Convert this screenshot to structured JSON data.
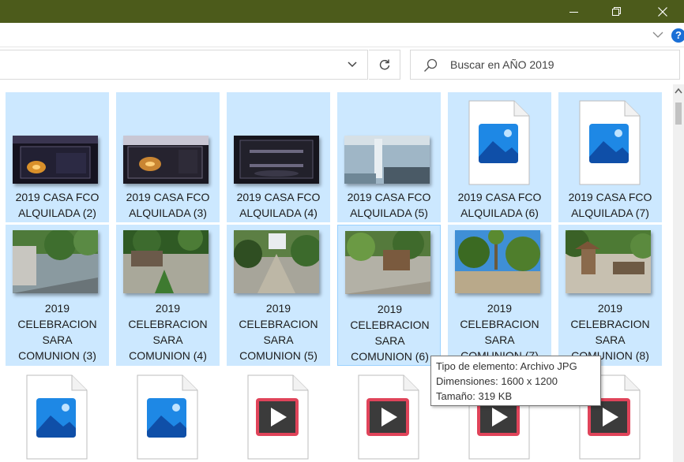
{
  "window": {
    "accent": "#4c5b1b",
    "buttons": [
      "minimize-icon",
      "maximize-icon",
      "close-icon"
    ]
  },
  "ribbon": {
    "help_label": "?"
  },
  "search": {
    "placeholder": "Buscar en AÑO 2019"
  },
  "row1": [
    {
      "line1": "2019 CASA FCO",
      "line2": "ALQUILADA (2)",
      "kind": "photo"
    },
    {
      "line1": "2019 CASA FCO",
      "line2": "ALQUILADA (3)",
      "kind": "photo"
    },
    {
      "line1": "2019 CASA FCO",
      "line2": "ALQUILADA (4)",
      "kind": "photo"
    },
    {
      "line1": "2019 CASA FCO",
      "line2": "ALQUILADA (5)",
      "kind": "photo"
    },
    {
      "line1": "2019 CASA FCO",
      "line2": "ALQUILADA (6)",
      "kind": "image-file-icon"
    },
    {
      "line1": "2019 CASA FCO",
      "line2": "ALQUILADA (7)",
      "kind": "image-file-icon"
    }
  ],
  "row2": [
    {
      "line1": "2019",
      "line2": "CELEBRACION",
      "line3": "SARA",
      "line4": "COMUNION (3)"
    },
    {
      "line1": "2019",
      "line2": "CELEBRACION",
      "line3": "SARA",
      "line4": "COMUNION (4)"
    },
    {
      "line1": "2019",
      "line2": "CELEBRACION",
      "line3": "SARA",
      "line4": "COMUNION (5)"
    },
    {
      "line1": "2019",
      "line2": "CELEBRACION",
      "line3": "SARA",
      "line4": "COMUNION (6)"
    },
    {
      "line1": "2019",
      "line2": "CELEBRACION",
      "line3": "SARA",
      "line4": "COMUNION (7)"
    },
    {
      "line1": "2019",
      "line2": "CELEBRACION",
      "line3": "SARA",
      "line4": "COMUNION (8)"
    }
  ],
  "row3": [
    "image-file-icon",
    "image-file-icon",
    "video-file-icon",
    "video-file-icon",
    "video-file-icon",
    "video-file-icon"
  ],
  "tooltip": {
    "line1": "Tipo de elemento: Archivo JPG",
    "line2": "Dimensiones: 1600 x 1200",
    "line3": "Tamaño: 319 KB"
  },
  "colors": {
    "selection": "#cce8ff",
    "selection_border": "#99d1ff"
  }
}
